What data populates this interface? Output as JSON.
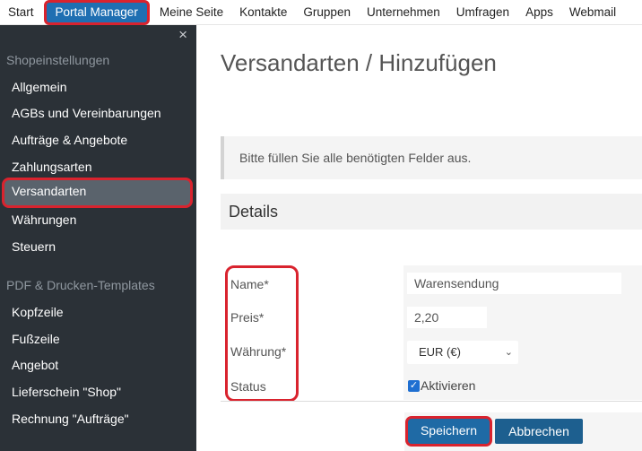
{
  "topnav": {
    "items": [
      "Start",
      "Portal Manager",
      "Meine Seite",
      "Kontakte",
      "Gruppen",
      "Unternehmen",
      "Umfragen",
      "Apps",
      "Webmail"
    ],
    "active_index": 1
  },
  "sidebar": {
    "close_icon": "×",
    "sections": [
      {
        "title": "Shopeinstellungen",
        "items": [
          "Allgemein",
          "AGBs und Vereinbarungen",
          "Aufträge & Angebote",
          "Zahlungsarten",
          "Versandarten",
          "Währungen",
          "Steuern"
        ]
      },
      {
        "title": "PDF & Drucken-Templates",
        "items": [
          "Kopfzeile",
          "Fußzeile",
          "Angebot",
          "Lieferschein \"Shop\"",
          "Rechnung \"Aufträge\""
        ]
      }
    ],
    "active_item": "Versandarten"
  },
  "main": {
    "title": "Versandarten / Hinzufügen",
    "info": "Bitte füllen Sie alle benötigten Felder aus.",
    "details_heading": "Details",
    "form": {
      "name_label": "Name*",
      "name_value": "Warensendung",
      "price_label": "Preis*",
      "price_value": "2,20",
      "currency_label": "Währung*",
      "currency_value": "EUR (€)",
      "status_label": "Status",
      "status_checkbox_label": "Aktivieren",
      "status_checked": true
    },
    "save_button": "Speichern",
    "cancel_button": "Abbrechen"
  },
  "colors": {
    "accent": "#1f6aa5",
    "sidebar_bg": "#2b3137",
    "highlight": "#d9232e"
  }
}
